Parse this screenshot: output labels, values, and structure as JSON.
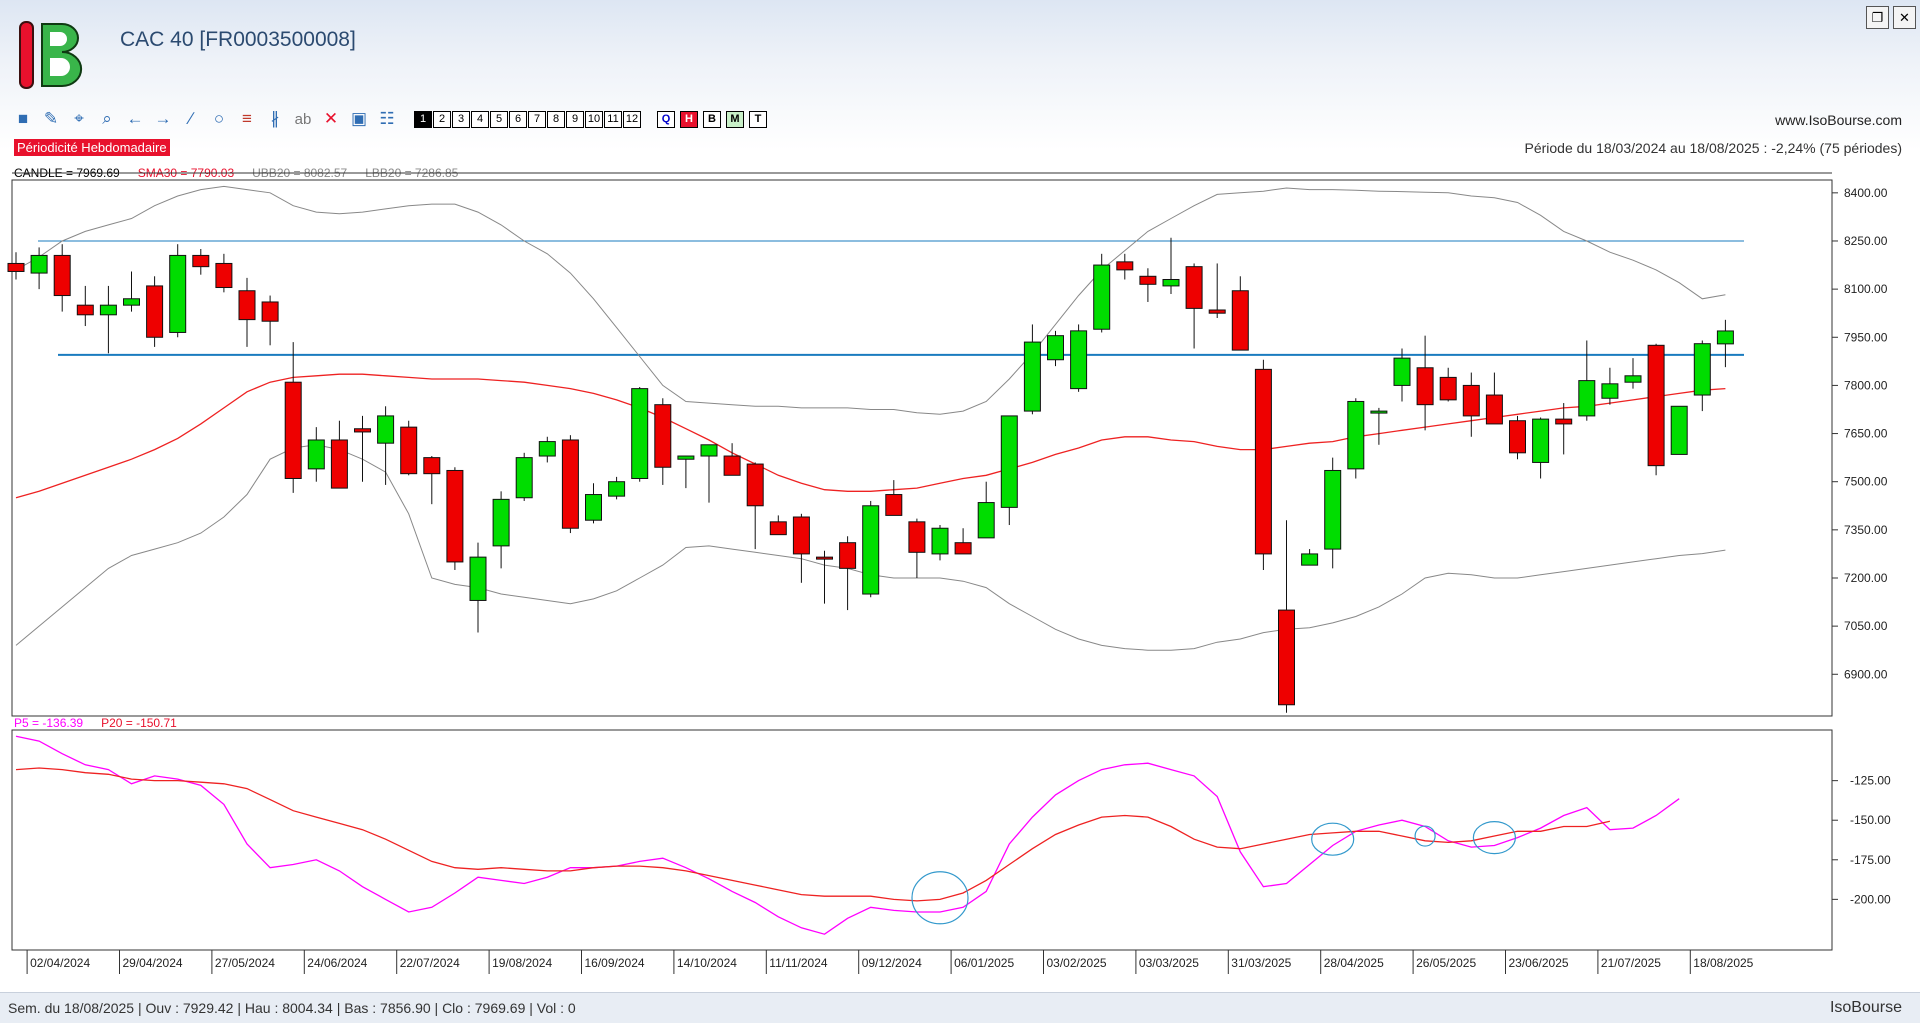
{
  "window": {
    "title": "CAC 40 [FR0003500008]",
    "restore_glyph": "❐",
    "close_glyph": "✕"
  },
  "toolbar": {
    "tools": [
      "square-icon",
      "pen-icon",
      "crosshair-icon",
      "zoom-icon",
      "arrow-left-icon",
      "arrow-right-icon",
      "line-icon",
      "circle-icon",
      "fibonacci-icon",
      "channel-icon",
      "text-icon",
      "delete-icon",
      "camera-icon",
      "tree-icon"
    ],
    "tool_glyphs": [
      "■",
      "✎",
      "⌖",
      "⌕",
      "←",
      "→",
      "∕",
      "○",
      "≡",
      "∦",
      "ab",
      "✕",
      "▣",
      "☷"
    ],
    "numbers": [
      "1",
      "2",
      "3",
      "4",
      "5",
      "6",
      "7",
      "8",
      "9",
      "10",
      "11",
      "12"
    ],
    "modes": [
      {
        "label": "Q",
        "color": "#0000cc",
        "bg": "#ffffff"
      },
      {
        "label": "H",
        "color": "#ffffff",
        "bg": "#e8112d"
      },
      {
        "label": "B",
        "color": "#000000",
        "bg": "#ffffff"
      },
      {
        "label": "M",
        "color": "#000000",
        "bg": "#c8f0c8"
      },
      {
        "label": "T",
        "color": "#000000",
        "bg": "#ffffff"
      }
    ]
  },
  "site_url": "www.IsoBourse.com",
  "periodicity_label": "Périodicité Hebdomadaire",
  "period_info": "Période du 18/03/2024 au 18/08/2025 : -2,24% (75 périodes)",
  "legend_main": [
    {
      "text": "CANDLE = 7969.69",
      "color": "#000000"
    },
    {
      "text": "SMA30 = 7790.03",
      "color": "#e8112d"
    },
    {
      "text": "UBB20 = 8082.57",
      "color": "#888888"
    },
    {
      "text": "LBB20 = 7286.85",
      "color": "#888888"
    }
  ],
  "legend_osc": [
    {
      "text": "P5 = -136.39",
      "color": "#ff00ff"
    },
    {
      "text": "P20 = -150.71",
      "color": "#e8112d"
    }
  ],
  "colors": {
    "up": "#00dd00",
    "down": "#ee0000",
    "sma": "#ee2222",
    "bands": "#888888",
    "hline": "#1a7bbf",
    "p5": "#ff00ff",
    "p20": "#ee2222",
    "circle": "#3399cc"
  },
  "chart_data": [
    {
      "type": "candlestick",
      "ylim": [
        6770,
        8440
      ],
      "yticks": [
        6900,
        7050,
        7200,
        7350,
        7500,
        7650,
        7800,
        7950,
        8100,
        8250,
        8400
      ],
      "x_labels": [
        {
          "i": 1,
          "label": "02/04/2024"
        },
        {
          "i": 5,
          "label": "29/04/2024"
        },
        {
          "i": 9,
          "label": "27/05/2024"
        },
        {
          "i": 13,
          "label": "24/06/2024"
        },
        {
          "i": 17,
          "label": "22/07/2024"
        },
        {
          "i": 21,
          "label": "19/08/2024"
        },
        {
          "i": 25,
          "label": "16/09/2024"
        },
        {
          "i": 29,
          "label": "14/10/2024"
        },
        {
          "i": 33,
          "label": "11/11/2024"
        },
        {
          "i": 37,
          "label": "09/12/2024"
        },
        {
          "i": 41,
          "label": "06/01/2025"
        },
        {
          "i": 45,
          "label": "03/02/2025"
        },
        {
          "i": 49,
          "label": "03/03/2025"
        },
        {
          "i": 53,
          "label": "31/03/2025"
        },
        {
          "i": 57,
          "label": "28/04/2025"
        },
        {
          "i": 61,
          "label": "26/05/2025"
        },
        {
          "i": 65,
          "label": "23/06/2025"
        },
        {
          "i": 69,
          "label": "21/07/2025"
        },
        {
          "i": 73,
          "label": "18/08/2025"
        }
      ],
      "ohlc": [
        [
          8180,
          8215,
          8130,
          8155
        ],
        [
          8150,
          8230,
          8100,
          8205
        ],
        [
          8205,
          8240,
          8030,
          8080
        ],
        [
          8050,
          8110,
          7985,
          8020
        ],
        [
          8020,
          8110,
          7900,
          8050
        ],
        [
          8050,
          8155,
          8030,
          8070
        ],
        [
          8110,
          8140,
          7920,
          7950
        ],
        [
          7965,
          8240,
          7950,
          8205
        ],
        [
          8205,
          8225,
          8145,
          8170
        ],
        [
          8180,
          8210,
          8090,
          8105
        ],
        [
          8095,
          8135,
          7920,
          8005
        ],
        [
          8060,
          8080,
          7925,
          8000
        ],
        [
          7810,
          7935,
          7465,
          7510
        ],
        [
          7540,
          7670,
          7500,
          7630
        ],
        [
          7630,
          7690,
          7490,
          7480
        ],
        [
          7665,
          7705,
          7500,
          7655
        ],
        [
          7620,
          7735,
          7490,
          7705
        ],
        [
          7670,
          7690,
          7520,
          7525
        ],
        [
          7575,
          7580,
          7430,
          7525
        ],
        [
          7535,
          7545,
          7225,
          7250
        ],
        [
          7130,
          7310,
          7030,
          7265
        ],
        [
          7300,
          7470,
          7230,
          7445
        ],
        [
          7450,
          7590,
          7440,
          7575
        ],
        [
          7580,
          7640,
          7560,
          7625
        ],
        [
          7630,
          7645,
          7340,
          7355
        ],
        [
          7380,
          7495,
          7370,
          7460
        ],
        [
          7455,
          7515,
          7445,
          7500
        ],
        [
          7510,
          7795,
          7500,
          7790
        ],
        [
          7740,
          7760,
          7490,
          7545
        ],
        [
          7570,
          7580,
          7480,
          7580
        ],
        [
          7580,
          7615,
          7435,
          7615
        ],
        [
          7580,
          7620,
          7525,
          7520
        ],
        [
          7555,
          7560,
          7290,
          7425
        ],
        [
          7375,
          7395,
          7340,
          7335
        ],
        [
          7390,
          7400,
          7185,
          7275
        ],
        [
          7265,
          7285,
          7120,
          7260
        ],
        [
          7310,
          7330,
          7100,
          7230
        ],
        [
          7150,
          7440,
          7140,
          7425
        ],
        [
          7460,
          7505,
          7400,
          7395
        ],
        [
          7375,
          7385,
          7200,
          7280
        ],
        [
          7275,
          7365,
          7255,
          7355
        ],
        [
          7310,
          7355,
          7285,
          7275
        ],
        [
          7325,
          7500,
          7325,
          7435
        ],
        [
          7420,
          7700,
          7365,
          7705
        ],
        [
          7720,
          7990,
          7710,
          7935
        ],
        [
          7880,
          7970,
          7860,
          7955
        ],
        [
          7790,
          7990,
          7780,
          7970
        ],
        [
          7975,
          8210,
          7965,
          8175
        ],
        [
          8185,
          8210,
          8130,
          8160
        ],
        [
          8140,
          8165,
          8060,
          8115
        ],
        [
          8110,
          8260,
          8085,
          8130
        ],
        [
          8170,
          8180,
          7915,
          8040
        ],
        [
          8035,
          8180,
          8010,
          8025
        ],
        [
          8095,
          8140,
          7910,
          7910
        ],
        [
          7850,
          7880,
          7225,
          7275
        ],
        [
          7100,
          7380,
          6780,
          6805
        ],
        [
          7240,
          7290,
          7240,
          7275
        ],
        [
          7290,
          7575,
          7230,
          7535
        ],
        [
          7540,
          7760,
          7510,
          7750
        ],
        [
          7715,
          7730,
          7615,
          7720
        ],
        [
          7800,
          7915,
          7750,
          7885
        ],
        [
          7855,
          7955,
          7660,
          7740
        ],
        [
          7825,
          7855,
          7750,
          7755
        ],
        [
          7800,
          7840,
          7640,
          7705
        ],
        [
          7770,
          7840,
          7690,
          7680
        ],
        [
          7690,
          7705,
          7570,
          7590
        ],
        [
          7560,
          7700,
          7510,
          7695
        ],
        [
          7695,
          7745,
          7585,
          7680
        ],
        [
          7705,
          7940,
          7690,
          7815
        ],
        [
          7760,
          7855,
          7740,
          7805
        ],
        [
          7810,
          7885,
          7790,
          7830
        ],
        [
          7925,
          7930,
          7520,
          7550
        ],
        [
          7585,
          7710,
          7585,
          7735
        ],
        [
          7770,
          7940,
          7720,
          7930
        ],
        [
          7929.42,
          8004.34,
          7856.9,
          7969.69
        ]
      ],
      "sma30": [
        7450,
        7470,
        7495,
        7520,
        7545,
        7570,
        7600,
        7635,
        7680,
        7730,
        7780,
        7810,
        7825,
        7830,
        7835,
        7835,
        7830,
        7825,
        7820,
        7820,
        7820,
        7815,
        7810,
        7800,
        7790,
        7775,
        7755,
        7730,
        7700,
        7665,
        7630,
        7590,
        7555,
        7520,
        7495,
        7475,
        7470,
        7470,
        7475,
        7480,
        7495,
        7510,
        7520,
        7540,
        7560,
        7585,
        7605,
        7630,
        7640,
        7640,
        7630,
        7625,
        7610,
        7600,
        7600,
        7610,
        7620,
        7625,
        7640,
        7650,
        7660,
        7670,
        7680,
        7690,
        7700,
        7710,
        7720,
        7730,
        7735,
        7745,
        7755,
        7765,
        7775,
        7785,
        7790
      ],
      "ubb20": [
        8160,
        8200,
        8250,
        8280,
        8300,
        8320,
        8360,
        8390,
        8410,
        8420,
        8410,
        8400,
        8360,
        8340,
        8335,
        8340,
        8350,
        8360,
        8365,
        8365,
        8340,
        8300,
        8250,
        8210,
        8150,
        8070,
        7980,
        7890,
        7800,
        7750,
        7745,
        7740,
        7735,
        7735,
        7730,
        7730,
        7730,
        7725,
        7725,
        7715,
        7710,
        7720,
        7750,
        7820,
        7900,
        7990,
        8080,
        8160,
        8220,
        8280,
        8320,
        8360,
        8395,
        8400,
        8405,
        8415,
        8410,
        8410,
        8408,
        8405,
        8404,
        8402,
        8400,
        8390,
        8385,
        8370,
        8330,
        8280,
        8250,
        8215,
        8190,
        8160,
        8120,
        8070,
        8082.57
      ],
      "lbb20": [
        6990,
        7050,
        7110,
        7170,
        7230,
        7270,
        7290,
        7310,
        7340,
        7390,
        7460,
        7570,
        7605,
        7615,
        7600,
        7570,
        7530,
        7400,
        7200,
        7180,
        7170,
        7150,
        7140,
        7130,
        7120,
        7135,
        7160,
        7200,
        7240,
        7295,
        7300,
        7290,
        7280,
        7270,
        7260,
        7240,
        7230,
        7210,
        7200,
        7200,
        7200,
        7190,
        7170,
        7120,
        7080,
        7040,
        7010,
        6990,
        6980,
        6975,
        6975,
        6980,
        7000,
        7010,
        7030,
        7040,
        7045,
        7060,
        7080,
        7110,
        7150,
        7200,
        7215,
        7210,
        7200,
        7200,
        7210,
        7220,
        7230,
        7240,
        7250,
        7260,
        7270,
        7276,
        7286.85
      ],
      "hlines": [
        {
          "value": 8250
        },
        {
          "value": 7895
        }
      ]
    },
    {
      "type": "line",
      "ylim": [
        -232,
        -93
      ],
      "yticks": [
        -125,
        -150,
        -175,
        -200
      ],
      "series": [
        {
          "name": "P5",
          "values": [
            -97,
            -100,
            -108,
            -115,
            -118,
            -127,
            -122,
            -124,
            -128,
            -140,
            -165,
            -180,
            -178,
            -175,
            -182,
            -192,
            -200,
            -208,
            -205,
            -196,
            -186,
            -188,
            -190,
            -186,
            -180,
            -180,
            -179,
            -176,
            -174,
            -180,
            -187,
            -195,
            -202,
            -211,
            -218,
            -222,
            -212,
            -205,
            -207,
            -208,
            -208,
            -205,
            -195,
            -165,
            -148,
            -134,
            -125,
            -118,
            -115,
            -114,
            -118,
            -122,
            -135,
            -170,
            -192,
            -190,
            -178,
            -166,
            -157,
            -153,
            -150,
            -154,
            -163,
            -167,
            -166,
            -161,
            -155,
            -147,
            -142,
            -156,
            -155,
            -147,
            -136.39
          ]
        },
        {
          "name": "P20",
          "values": [
            -118,
            -117,
            -118,
            -120,
            -121,
            -124,
            -125,
            -125,
            -126,
            -127,
            -130,
            -137,
            -144,
            -148,
            -152,
            -156,
            -162,
            -169,
            -176,
            -180,
            -181,
            -180,
            -181,
            -182,
            -182,
            -180,
            -179,
            -179,
            -180,
            -182,
            -185,
            -188,
            -191,
            -194,
            -197,
            -198,
            -198,
            -198,
            -200,
            -201,
            -200,
            -196,
            -188,
            -178,
            -168,
            -159,
            -153,
            -148,
            -147,
            -148,
            -154,
            -162,
            -167,
            -168,
            -165,
            -162,
            -159,
            -158,
            -157,
            -157,
            -160,
            -163,
            -164,
            -163,
            -160,
            -157,
            -157,
            -154,
            -154,
            -150.71
          ]
        }
      ],
      "markers": [
        {
          "i": 40,
          "value": -199
        },
        {
          "i": 57,
          "value": -162
        },
        {
          "i": 61,
          "value": -160
        },
        {
          "i": 64,
          "value": -161
        }
      ]
    }
  ],
  "status": {
    "text": "Sem. du 18/08/2025 | Ouv : 7929.42 | Hau : 8004.34 | Bas : 7856.90 | Clo : 7969.69 | Vol : 0",
    "brand": "IsoBourse"
  }
}
